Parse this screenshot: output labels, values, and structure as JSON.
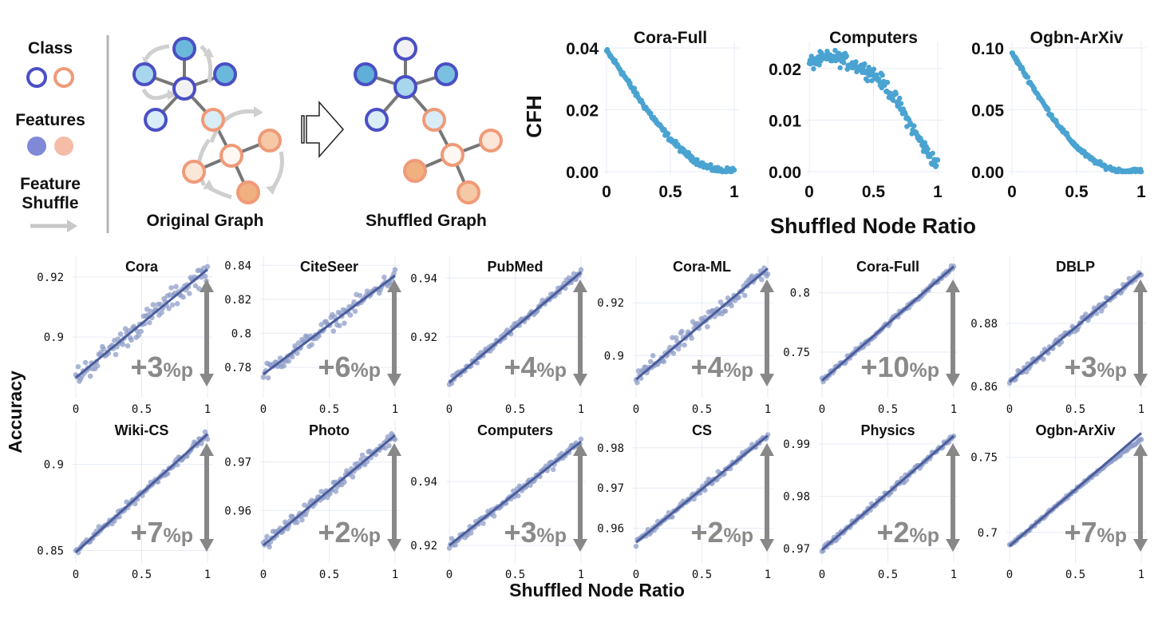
{
  "legend": {
    "class_title": "Class",
    "features_title": "Features",
    "shuffle_title_line1": "Feature",
    "shuffle_title_line2": "Shuffle",
    "class_colors": [
      "#4a4fc4",
      "#ef9a78"
    ],
    "feature_colors": [
      "#8088d8",
      "#f5bca8"
    ]
  },
  "diagram": {
    "original_label": "Original Graph",
    "shuffled_label": "Shuffled Graph"
  },
  "colors": {
    "cfh_points": "#4aa3d1",
    "acc_points": "#8f9dc8",
    "fit_line": "#4a5d9c",
    "arrow": "#888888",
    "annotation": "#8a8a8a",
    "grid": "#e6ebf5"
  },
  "chart_data": [
    {
      "type": "scatter",
      "group": "cfh",
      "title": "Cora-Full",
      "xlabel": "Shuffled Node Ratio",
      "ylabel": "CFH",
      "xlim": [
        0,
        1
      ],
      "ylim": [
        0,
        0.04
      ],
      "yticks": [
        0,
        0.02,
        0.04
      ],
      "ytick_labels": [
        "0.00",
        "0.02",
        "0.04"
      ],
      "xticks": [
        0,
        0.5,
        1
      ],
      "xtick_labels": [
        "0",
        "0.5",
        "1"
      ],
      "curve": {
        "x": [
          0,
          0.1,
          0.2,
          0.3,
          0.4,
          0.5,
          0.6,
          0.7,
          0.8,
          0.9,
          1.0
        ],
        "y": [
          0.039,
          0.0335,
          0.027,
          0.021,
          0.0155,
          0.0105,
          0.0065,
          0.0035,
          0.0012,
          0.0003,
          0.0005
        ]
      },
      "noise": 0.0008
    },
    {
      "type": "scatter",
      "group": "cfh",
      "title": "Computers",
      "xlim": [
        0,
        1
      ],
      "ylim": [
        0,
        0.024
      ],
      "yticks": [
        0,
        0.01,
        0.02
      ],
      "ytick_labels": [
        "0.00",
        "0.01",
        "0.02"
      ],
      "xticks": [
        0,
        0.5,
        1
      ],
      "xtick_labels": [
        "0",
        "0.5",
        "1"
      ],
      "curve": {
        "x": [
          0,
          0.1,
          0.2,
          0.3,
          0.4,
          0.5,
          0.6,
          0.7,
          0.8,
          0.9,
          1.0
        ],
        "y": [
          0.021,
          0.0218,
          0.0222,
          0.0212,
          0.0202,
          0.019,
          0.0165,
          0.013,
          0.0085,
          0.0045,
          0.0012
        ]
      },
      "noise": 0.0012
    },
    {
      "type": "scatter",
      "group": "cfh",
      "title": "Ogbn-ArXiv",
      "xlim": [
        0,
        1
      ],
      "ylim": [
        0,
        0.1
      ],
      "yticks": [
        0,
        0.05,
        0.1
      ],
      "ytick_labels": [
        "0.00",
        "0.05",
        "0.10"
      ],
      "xticks": [
        0,
        0.5,
        1
      ],
      "xtick_labels": [
        "0",
        "0.5",
        "1"
      ],
      "curve": {
        "x": [
          0,
          0.1,
          0.2,
          0.3,
          0.4,
          0.5,
          0.6,
          0.7,
          0.8,
          0.9,
          1.0
        ],
        "y": [
          0.096,
          0.079,
          0.062,
          0.046,
          0.032,
          0.02,
          0.011,
          0.005,
          0.0012,
          0.0003,
          0.001
        ]
      },
      "noise": 0.0015
    },
    {
      "type": "scatter",
      "group": "acc",
      "title": "Cora",
      "ylabel": "Accuracy",
      "ylim": [
        0.882,
        0.925
      ],
      "yticks": [
        0.9,
        0.92
      ],
      "ytick_labels": [
        "0.9",
        "0.92"
      ],
      "xticks": [
        0,
        0.5,
        1
      ],
      "xtick_labels": [
        "0",
        "0.5",
        "1"
      ],
      "fit": [
        0.8865,
        0.9225
      ],
      "noise": 0.003,
      "annotation": "+3",
      "annotation_suffix": "%p"
    },
    {
      "type": "scatter",
      "group": "acc",
      "title": "CiteSeer",
      "ylim": [
        0.766,
        0.842
      ],
      "yticks": [
        0.78,
        0.8,
        0.82,
        0.84
      ],
      "ytick_labels": [
        "0.78",
        "0.8",
        "0.82",
        "0.84"
      ],
      "xticks": [
        0,
        0.5,
        1
      ],
      "xtick_labels": [
        "0",
        "0.5",
        "1"
      ],
      "fit": [
        0.776,
        0.834
      ],
      "noise": 0.004,
      "annotation": "+6",
      "annotation_suffix": "%p"
    },
    {
      "type": "scatter",
      "group": "acc",
      "title": "PubMed",
      "ylim": [
        0.9015,
        0.9455
      ],
      "yticks": [
        0.92,
        0.94
      ],
      "ytick_labels": [
        "0.92",
        "0.94"
      ],
      "xticks": [
        0,
        0.5,
        1
      ],
      "xtick_labels": [
        "0",
        "0.5",
        "1"
      ],
      "fit": [
        0.9045,
        0.942
      ],
      "noise": 0.0012,
      "annotation": "+4",
      "annotation_suffix": "%p"
    },
    {
      "type": "scatter",
      "group": "acc",
      "title": "Cora-ML",
      "ylim": [
        0.8865,
        0.9355
      ],
      "yticks": [
        0.9,
        0.92
      ],
      "ytick_labels": [
        "0.9",
        "0.92"
      ],
      "xticks": [
        0,
        0.5,
        1
      ],
      "xtick_labels": [
        "0",
        "0.5",
        "1"
      ],
      "fit": [
        0.891,
        0.933
      ],
      "noise": 0.003,
      "annotation": "+4",
      "annotation_suffix": "%p"
    },
    {
      "type": "scatter",
      "group": "acc",
      "title": "Cora-Full",
      "ylim": [
        0.717,
        0.826
      ],
      "yticks": [
        0.75,
        0.8
      ],
      "ytick_labels": [
        "0.75",
        "0.8"
      ],
      "xticks": [
        0,
        0.5,
        1
      ],
      "xtick_labels": [
        "0",
        "0.5",
        "1"
      ],
      "fit": [
        0.726,
        0.822
      ],
      "noise": 0.002,
      "annotation": "+10",
      "annotation_suffix": "%p"
    },
    {
      "type": "scatter",
      "group": "acc",
      "title": "DBLP",
      "ylim": [
        0.8585,
        0.8995
      ],
      "yticks": [
        0.86,
        0.88
      ],
      "ytick_labels": [
        "0.86",
        "0.88"
      ],
      "xticks": [
        0,
        0.5,
        1
      ],
      "xtick_labels": [
        "0",
        "0.5",
        "1"
      ],
      "fit": [
        0.8615,
        0.896
      ],
      "noise": 0.0012,
      "annotation": "+3",
      "annotation_suffix": "%p"
    },
    {
      "type": "scatter",
      "group": "acc",
      "title": "Wiki-CS",
      "ylim": [
        0.8465,
        0.9225
      ],
      "yticks": [
        0.85,
        0.9
      ],
      "ytick_labels": [
        "0.85",
        "0.9"
      ],
      "xticks": [
        0,
        0.5,
        1
      ],
      "xtick_labels": [
        "0",
        "0.5",
        "1"
      ],
      "fit": [
        0.849,
        0.9175
      ],
      "noise": 0.002,
      "annotation": "+7",
      "annotation_suffix": "%p"
    },
    {
      "type": "scatter",
      "group": "acc",
      "title": "Photo",
      "ylim": [
        0.9505,
        0.9775
      ],
      "yticks": [
        0.96,
        0.97
      ],
      "ytick_labels": [
        "0.96",
        "0.97"
      ],
      "xticks": [
        0,
        0.5,
        1
      ],
      "xtick_labels": [
        "0",
        "0.5",
        "1"
      ],
      "fit": [
        0.9528,
        0.9755
      ],
      "noise": 0.0011,
      "annotation": "+2",
      "annotation_suffix": "%p"
    },
    {
      "type": "scatter",
      "group": "acc",
      "title": "Computers",
      "ylim": [
        0.9165,
        0.9575
      ],
      "yticks": [
        0.92,
        0.94
      ],
      "ytick_labels": [
        "0.92",
        "0.94"
      ],
      "xticks": [
        0,
        0.5,
        1
      ],
      "xtick_labels": [
        "0",
        "0.5",
        "1"
      ],
      "fit": [
        0.92,
        0.9525
      ],
      "noise": 0.0013,
      "annotation": "+3",
      "annotation_suffix": "%p"
    },
    {
      "type": "scatter",
      "group": "acc",
      "title": "CS",
      "ylim": [
        0.953,
        0.9855
      ],
      "yticks": [
        0.96,
        0.97,
        0.98
      ],
      "ytick_labels": [
        "0.96",
        "0.97",
        "0.98"
      ],
      "xticks": [
        0,
        0.5,
        1
      ],
      "xtick_labels": [
        "0",
        "0.5",
        "1"
      ],
      "fit": [
        0.9565,
        0.983
      ],
      "noise": 0.0008,
      "annotation": "+2",
      "annotation_suffix": "%p"
    },
    {
      "type": "scatter",
      "group": "acc",
      "title": "Physics",
      "ylim": [
        0.9685,
        0.9935
      ],
      "yticks": [
        0.97,
        0.98,
        0.99
      ],
      "ytick_labels": [
        "0.97",
        "0.98",
        "0.99"
      ],
      "xticks": [
        0,
        0.5,
        1
      ],
      "xtick_labels": [
        "0",
        "0.5",
        "1"
      ],
      "fit": [
        0.9698,
        0.9915
      ],
      "noise": 0.0005,
      "annotation": "+2",
      "annotation_suffix": "%p"
    },
    {
      "type": "scatter",
      "group": "acc",
      "title": "Ogbn-ArXiv",
      "ylim": [
        0.684,
        0.771
      ],
      "yticks": [
        0.7,
        0.75
      ],
      "ytick_labels": [
        "0.7",
        "0.75"
      ],
      "xticks": [
        0,
        0.5,
        1
      ],
      "xtick_labels": [
        "0",
        "0.5",
        "1"
      ],
      "fit": [
        0.691,
        0.766
      ],
      "noise": 0.0008,
      "annotation": "+7",
      "annotation_suffix": "%p",
      "point_end": 0.762
    }
  ],
  "axes": {
    "cfh_ylabel": "CFH",
    "cfh_xlabel": "Shuffled Node Ratio",
    "acc_ylabel": "Accuracy",
    "acc_xlabel": "Shuffled Node Ratio"
  }
}
